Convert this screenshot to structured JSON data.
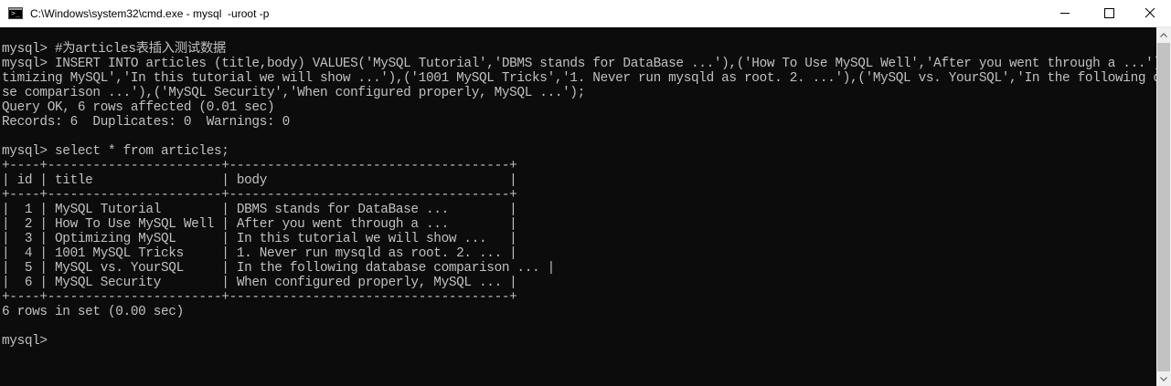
{
  "window": {
    "title": "C:\\Windows\\system32\\cmd.exe - mysql  -uroot -p",
    "icon": "cmd-icon",
    "controls": {
      "minimize": "minimize-icon",
      "maximize": "maximize-icon",
      "close": "close-icon"
    }
  },
  "console": {
    "lines": [
      "mysql> #为articles表插入测试数据",
      "mysql> INSERT INTO articles (title,body) VALUES('MySQL Tutorial','DBMS stands for DataBase ...'),('How To Use MySQL Well','After you went through a ...'),('Op",
      "timizing MySQL','In this tutorial we will show ...'),('1001 MySQL Tricks','1. Never run mysqld as root. 2. ...'),('MySQL vs. YourSQL','In the following databa",
      "se comparison ...'),('MySQL Security','When configured properly, MySQL ...');",
      "Query OK, 6 rows affected (0.01 sec)",
      "Records: 6  Duplicates: 0  Warnings: 0",
      "",
      "mysql> select * from articles;",
      "+----+-----------------------+-------------------------------------+",
      "| id | title                 | body                                |",
      "+----+-----------------------+-------------------------------------+",
      "|  1 | MySQL Tutorial        | DBMS stands for DataBase ...        |",
      "|  2 | How To Use MySQL Well | After you went through a ...        |",
      "|  3 | Optimizing MySQL      | In this tutorial we will show ...   |",
      "|  4 | 1001 MySQL Tricks     | 1. Never run mysqld as root. 2. ... |",
      "|  5 | MySQL vs. YourSQL     | In the following database comparison ... |",
      "|  6 | MySQL Security        | When configured properly, MySQL ... |",
      "+----+-----------------------+-------------------------------------+",
      "6 rows in set (0.00 sec)",
      "",
      "mysql> "
    ]
  },
  "scrollbar": {
    "up": "scroll-up-arrow-icon",
    "down": "scroll-down-arrow-icon"
  },
  "colors": {
    "console_bg": "#0c0c0c",
    "console_fg": "#c0c0c0",
    "titlebar_bg": "#ffffff"
  }
}
